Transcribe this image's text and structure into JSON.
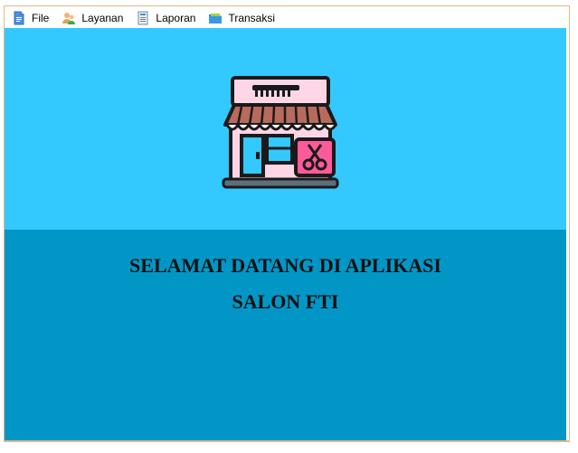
{
  "menubar": {
    "items": [
      {
        "label": "File",
        "icon": "document-icon"
      },
      {
        "label": "Layanan",
        "icon": "users-icon"
      },
      {
        "label": "Laporan",
        "icon": "report-icon"
      },
      {
        "label": "Transaksi",
        "icon": "folder-icon"
      }
    ]
  },
  "main": {
    "logo": "salon-store-icon",
    "welcome_line1": "SELAMAT DATANG DI APLIKASI",
    "welcome_line2": "SALON FTI"
  },
  "colors": {
    "top_panel": "#33c9ff",
    "bottom_panel": "#0296c7",
    "window_border": "#e3b98b"
  }
}
